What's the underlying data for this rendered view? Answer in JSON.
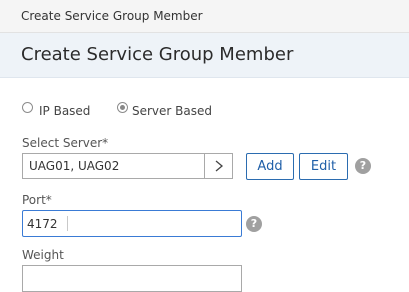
{
  "window": {
    "title": "Create Service Group Member"
  },
  "header": {
    "title": "Create Service Group Member"
  },
  "type_selector": {
    "options": [
      {
        "label": "IP Based",
        "checked": false
      },
      {
        "label": "Server Based",
        "checked": true
      }
    ]
  },
  "select_server": {
    "label": "Select Server*",
    "value": "UAG01, UAG02",
    "arrow_icon": "chevron-right-icon",
    "add_label": "Add",
    "edit_label": "Edit",
    "help_label": "?"
  },
  "port": {
    "label": "Port*",
    "value": "4172",
    "help_label": "?"
  },
  "weight": {
    "label": "Weight",
    "value": ""
  },
  "colors": {
    "accent": "#1f5fa8",
    "focus_border": "#3a7bd5",
    "header_bg": "#eef3f8"
  }
}
